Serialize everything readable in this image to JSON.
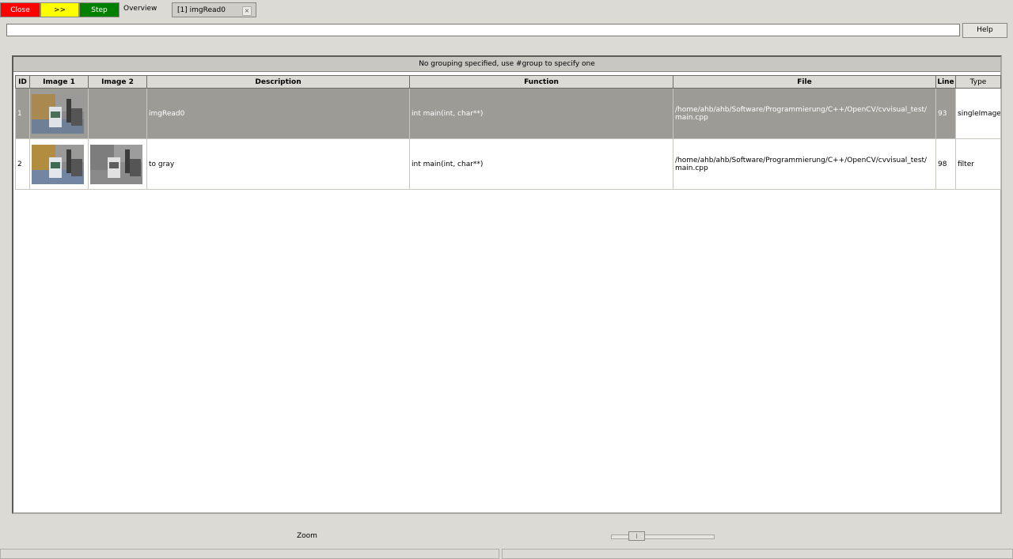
{
  "toolbar": {
    "close_label": "Close",
    "forward_label": ">>",
    "step_label": "Step",
    "colors": {
      "close": "#ff0000",
      "forward": "#ffff00",
      "step": "#008000"
    }
  },
  "tabs": [
    {
      "label": "Overview"
    },
    {
      "label": "[1] imgRead0",
      "close_icon": "close-icon"
    }
  ],
  "search": {
    "value": "",
    "placeholder": ""
  },
  "help_label": "Help",
  "group_message": "No grouping specified, use #group to specify one",
  "columns": [
    "ID",
    "Image 1",
    "Image 2",
    "Description",
    "Function",
    "File",
    "Line",
    "Type"
  ],
  "rows": [
    {
      "id": "1",
      "image1": "color-photo-thumbnail",
      "image2": "",
      "description": "imgRead0",
      "function": "int main(int, char**)",
      "file_line1": "/home/ahb/ahb/Software/Programmierung/C++/OpenCV/cvvisual_test/",
      "file_line2": "main.cpp",
      "line": "93",
      "type": "singleImage",
      "selected": true
    },
    {
      "id": "2",
      "image1": "color-photo-thumbnail",
      "image2": "grayscale-photo-thumbnail",
      "description": "to gray",
      "function": "int main(int, char**)",
      "file_line1": "/home/ahb/ahb/Software/Programmierung/C++/OpenCV/cvvisual_test/",
      "file_line2": "main.cpp",
      "line": "98",
      "type": "filter",
      "selected": false
    }
  ],
  "zoom_label": "Zoom",
  "zoom_level": 0.22
}
